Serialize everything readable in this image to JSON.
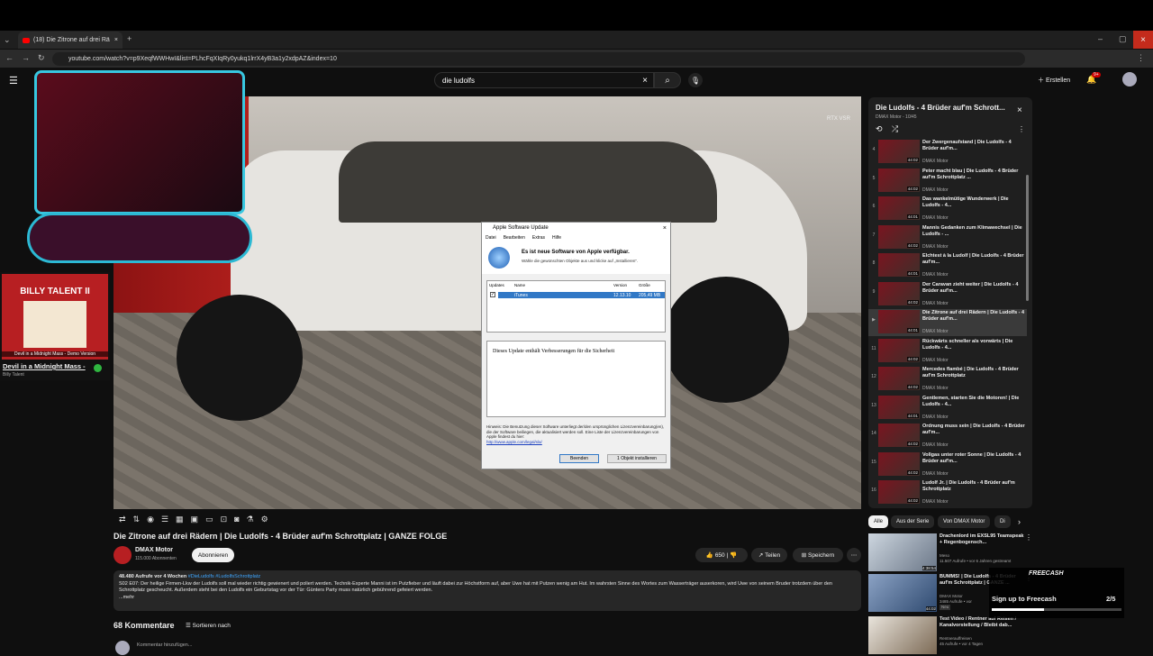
{
  "browser": {
    "tab_title": "(18) Die Zitrone auf drei Rä",
    "url": "youtube.com/watch?v=p9XeqfWWHwI&list=PLhcFqXIqRy0yukq1lrrX4yB3a1y2xdpAZ&index=10"
  },
  "header": {
    "search_value": "die ludolfs",
    "create_label": "Erstellen",
    "notif_badge": "9+"
  },
  "player_watermark": "RTX VSR",
  "music": {
    "album": "BILLY TALENT II",
    "caption": "Devil in a Midnight Mass - Demo Version",
    "song": "Devil in a Midnight Mass -",
    "artist": "Billy Talent"
  },
  "dialog": {
    "title": "Apple Software Update",
    "menu": [
      "Datei",
      "Bearbeiten",
      "Extras",
      "Hilfe"
    ],
    "heading": "Es ist neue Software von Apple verfügbar.",
    "sub": "Wähle die gewünschten Objekte aus und klicke auf „Installieren“.",
    "cols": [
      "Updates",
      "Name",
      "Version",
      "Größe"
    ],
    "item_name": "iTunes",
    "item_version": "12.13.10",
    "item_size": "205,49 MB",
    "desc": "Dieses Update enthält Verbesserungen für die Sicherheit",
    "note": "Hinweis: Die Benutzung dieser Software unterliegt der/den ursprünglichen Lizenzvereinbarung(en), die der Software beiliegen, die aktualisiert werden soll. Eine Liste der Lizenzvereinbarungen von Apple findest du hier:",
    "link": "http://www.apple.com/legal/sla/",
    "btn_quit": "Beenden",
    "btn_install": "1 Objekt installieren"
  },
  "video": {
    "title": "Die Zitrone auf drei Rädern | Die Ludolfs - 4 Brüder auf'm Schrottplatz | GANZE FOLGE",
    "channel": "DMAX Motor",
    "subs": "115.000 Abonnenten",
    "subscribe": "Abonnieren",
    "likes": "650",
    "share": "Teilen",
    "save": "Speichern",
    "desc_meta": "48.480 Aufrufe  vor 4 Wochen",
    "desc_tags": "#DieLudolfs #LudolfsSchrottplatz",
    "desc_text": "S02 E07: Der heilige Firmen-Lkw der Ludolfs soll mal wieder richtig gewienert und poliert werden. Technik-Experte Manni ist im Putzfieber und läuft dabei zur Höchstform auf, aber Uwe hat mit Putzen wenig am Hut. Im wahrsten Sinne des Wortes zum Wasserträger auserkoren, wird Uwe von seinem Bruder trotzdem über den Schrottplatz gescheucht. Außerdem steht bei den Ludolfs ein Geburtstag vor der Tür: Günters Party muss natürlich gebührend gefeiert werden.",
    "more": "...mehr",
    "comments": "68 Kommentare",
    "sort": "Sortieren nach",
    "add_comment": "Kommentar hinzufügen..."
  },
  "playlist": {
    "title": "Die Ludolfs - 4 Brüder auf'm Schrott...",
    "sub": "DMAX Motor - 10/45",
    "items": [
      {
        "n": "4",
        "t": "Der Zwergenaufstand | Die Ludolfs - 4 Brüder auf'm...",
        "d": "44:02",
        "c": "DMAX Motor"
      },
      {
        "n": "5",
        "t": "Peter macht blau | Die Ludolfs - 4 Brüder auf'm Schrottplatz ...",
        "d": "44:02",
        "c": "DMAX Motor"
      },
      {
        "n": "6",
        "t": "Das wankelmütige Wunderwerk | Die Ludolfs - 4...",
        "d": "44:01",
        "c": "DMAX Motor"
      },
      {
        "n": "7",
        "t": "Mannis Gedanken zum Klimawechsel | Die Ludolfs - ...",
        "d": "44:02",
        "c": "DMAX Motor"
      },
      {
        "n": "8",
        "t": "Elchtest à la Ludolf | Die Ludolfs - 4 Brüder auf'm...",
        "d": "44:01",
        "c": "DMAX Motor"
      },
      {
        "n": "9",
        "t": "Der Caravan zieht weiter | Die Ludolfs - 4 Brüder auf'm...",
        "d": "44:02",
        "c": "DMAX Motor"
      },
      {
        "n": "▶",
        "t": "Die Zitrone auf drei Rädern | Die Ludolfs - 4 Brüder auf'm...",
        "d": "44:01",
        "c": "DMAX Motor"
      },
      {
        "n": "11",
        "t": "Rückwärts schneller als vorwärts | Die Ludolfs - 4...",
        "d": "44:02",
        "c": "DMAX Motor"
      },
      {
        "n": "12",
        "t": "Mercedes flambé | Die Ludolfs - 4 Brüder auf'm Schrottplatz",
        "d": "44:02",
        "c": "DMAX Motor"
      },
      {
        "n": "13",
        "t": "Gentlemen, starten Sie die Motoren! | Die Ludolfs - 4...",
        "d": "44:01",
        "c": "DMAX Motor"
      },
      {
        "n": "14",
        "t": "Ordnung muss sein | Die Ludolfs - 4 Brüder auf'm...",
        "d": "44:02",
        "c": "DMAX Motor"
      },
      {
        "n": "15",
        "t": "Vollgas unter roter Sonne | Die Ludolfs - 4 Brüder auf'm...",
        "d": "44:02",
        "c": "DMAX Motor"
      },
      {
        "n": "16",
        "t": "Ludolf Jr. | Die Ludolfs - 4 Brüder auf'm Schrottplatz",
        "d": "44:02",
        "c": "DMAX Motor"
      }
    ]
  },
  "chips": [
    "Alle",
    "Aus der Serie",
    "Von DMAX Motor",
    "Di"
  ],
  "recs": [
    {
      "t": "Drachenlord im EXSL95 Teamspeak + Regenbogensch...",
      "d": "4:38:54",
      "m1": "Meso",
      "m2": "11.507 Aufrufe • vor 6 Jahren gestreamt"
    },
    {
      "t": "BUMMS! | Die Ludolfs - 4 Brüder auf'm Schrottplatz | GANZE ...",
      "d": "44:02",
      "m1": "DMAX Motor",
      "m2": "3485 Aufrufe • vor",
      "m3": "Neu"
    },
    {
      "t": "Test Video / Rentner auf Reisen / Kanalvorstellung / Bleibt dab...",
      "d": "",
      "m1": "Rentnerauffreisen",
      "m2": "45 Aufrufe • vor 4 Tagen"
    }
  ],
  "freecash": {
    "brand": "FREECASH",
    "cta": "Sign up to Freecash",
    "count": "2/5"
  }
}
